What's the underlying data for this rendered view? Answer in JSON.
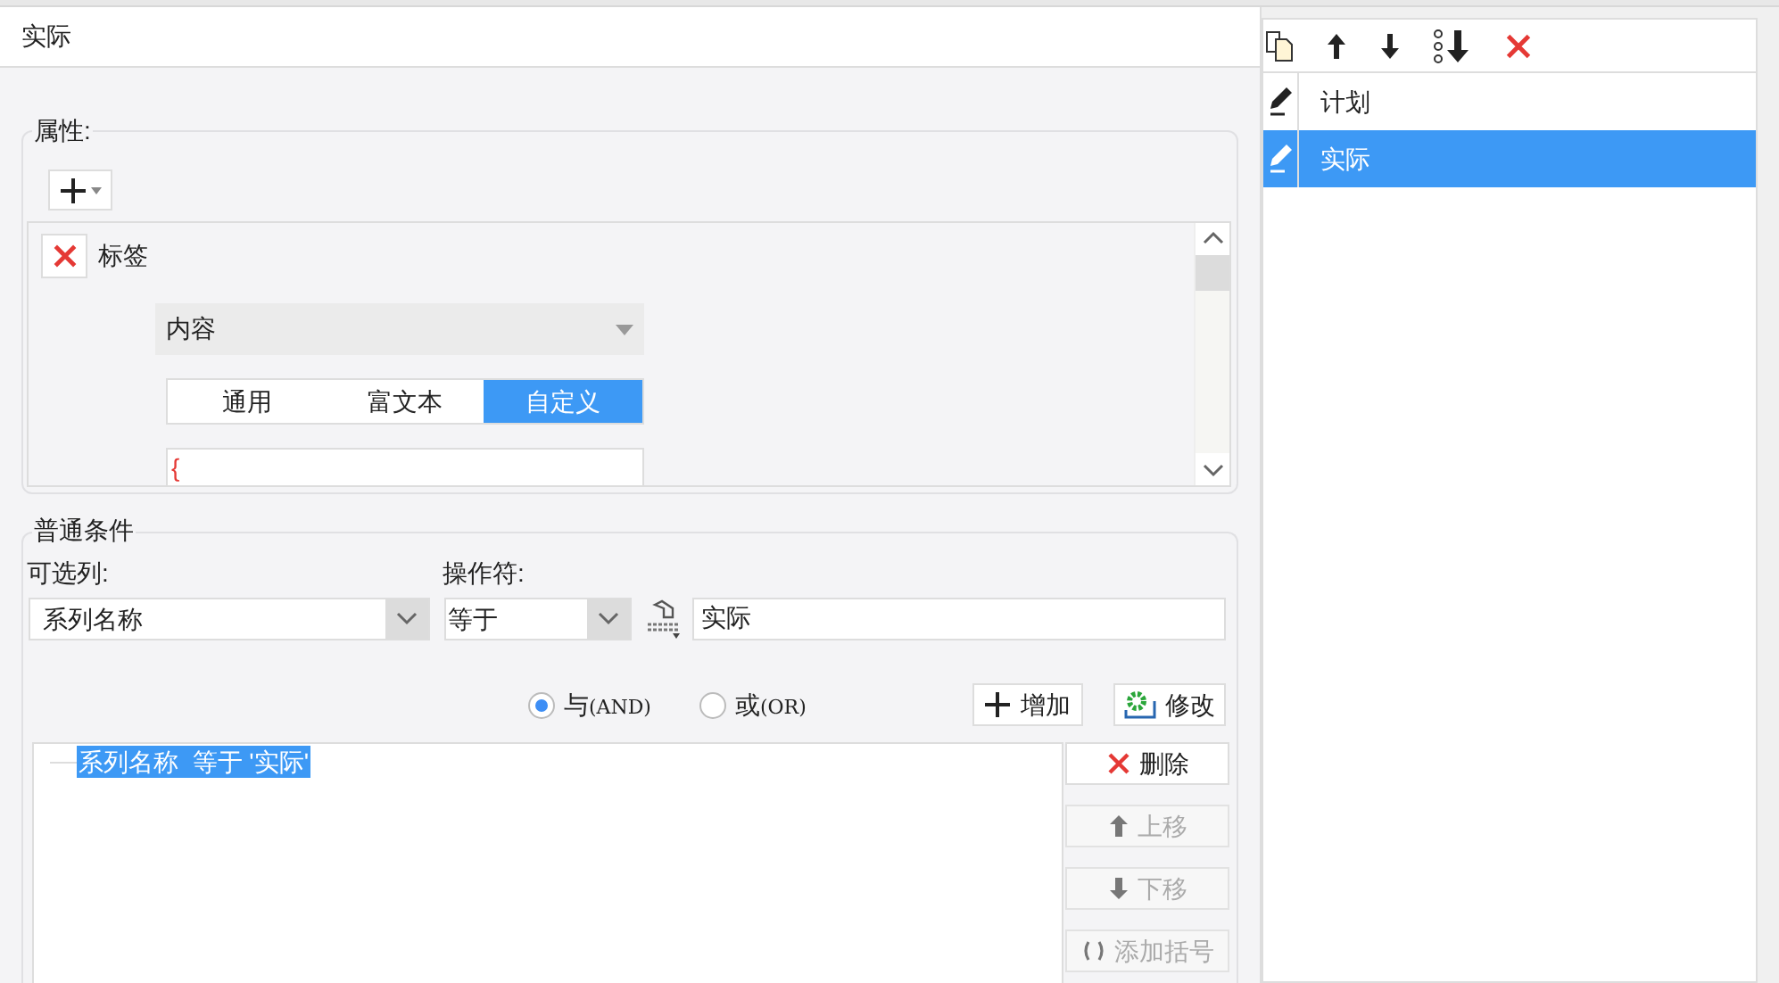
{
  "dialog": {
    "title": "实际",
    "properties": {
      "label": "属性:",
      "item": {
        "name": "标签",
        "content_select": {
          "value": "内容"
        },
        "tabs": [
          {
            "label": "通用",
            "selected": false
          },
          {
            "label": "富文本",
            "selected": false
          },
          {
            "label": "自定义",
            "selected": true
          }
        ],
        "editor_text": "{"
      }
    },
    "conditions": {
      "label": "普通条件",
      "column_label": "可选列:",
      "operator_label": "操作符:",
      "column_value": "系列名称",
      "operator_value": "等于",
      "value": "实际",
      "logic": [
        {
          "label": "与",
          "suffix": "(AND)",
          "selected": true
        },
        {
          "label": "或",
          "suffix": "(OR)",
          "selected": false
        }
      ],
      "add_button": "增加",
      "modify_button": "修改",
      "list": [
        {
          "text": "系列名称  等于 '实际'",
          "selected": true
        }
      ],
      "side_buttons": [
        {
          "kind": "delete",
          "label": "删除",
          "disabled": false
        },
        {
          "kind": "up",
          "label": "上移",
          "disabled": true
        },
        {
          "kind": "down",
          "label": "下移",
          "disabled": true
        },
        {
          "kind": "bracket",
          "label": "添加括号",
          "disabled": true
        }
      ]
    }
  },
  "series_list": [
    {
      "name": "计划",
      "selected": false
    },
    {
      "name": "实际",
      "selected": true
    }
  ]
}
